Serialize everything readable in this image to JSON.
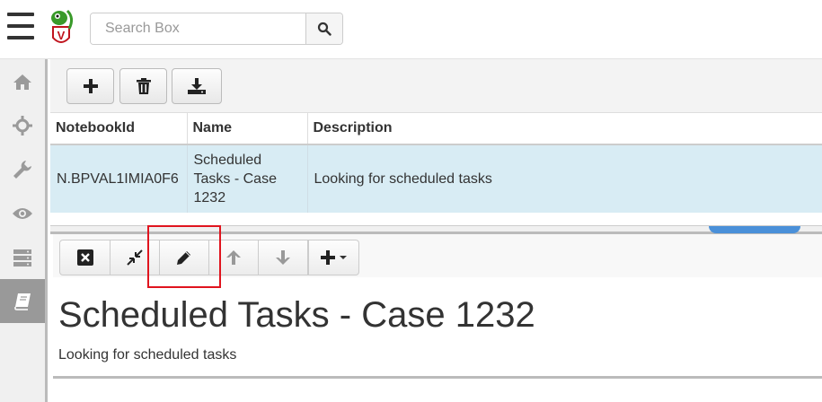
{
  "search": {
    "placeholder": "Search Box"
  },
  "sidebar": {
    "items": [
      {
        "icon": "home-icon"
      },
      {
        "icon": "crosshair-icon"
      },
      {
        "icon": "wrench-icon"
      },
      {
        "icon": "eye-icon"
      },
      {
        "icon": "server-icon"
      },
      {
        "icon": "notebook-icon",
        "active": true
      }
    ]
  },
  "toolbar": {
    "buttons": [
      {
        "icon": "plus-icon"
      },
      {
        "icon": "trash-icon"
      },
      {
        "icon": "download-icon"
      }
    ]
  },
  "table": {
    "headers": [
      "NotebookId",
      "Name",
      "Description"
    ],
    "rows": [
      {
        "id": "N.BPVAL1IMIA0F6",
        "name": "Scheduled Tasks - Case 1232",
        "description": "Looking for scheduled tasks"
      }
    ]
  },
  "cell_toolbar": {
    "buttons": [
      "close-icon",
      "collapse-icon",
      "edit-icon",
      "arrow-up-icon",
      "arrow-down-icon",
      "add-dropdown-icon"
    ]
  },
  "cell": {
    "title": "Scheduled Tasks - Case 1232",
    "description": "Looking for scheduled tasks"
  },
  "colors": {
    "selected_row": "#d8ecf4",
    "highlight": "#e0141e",
    "accent": "#4a90d9"
  }
}
